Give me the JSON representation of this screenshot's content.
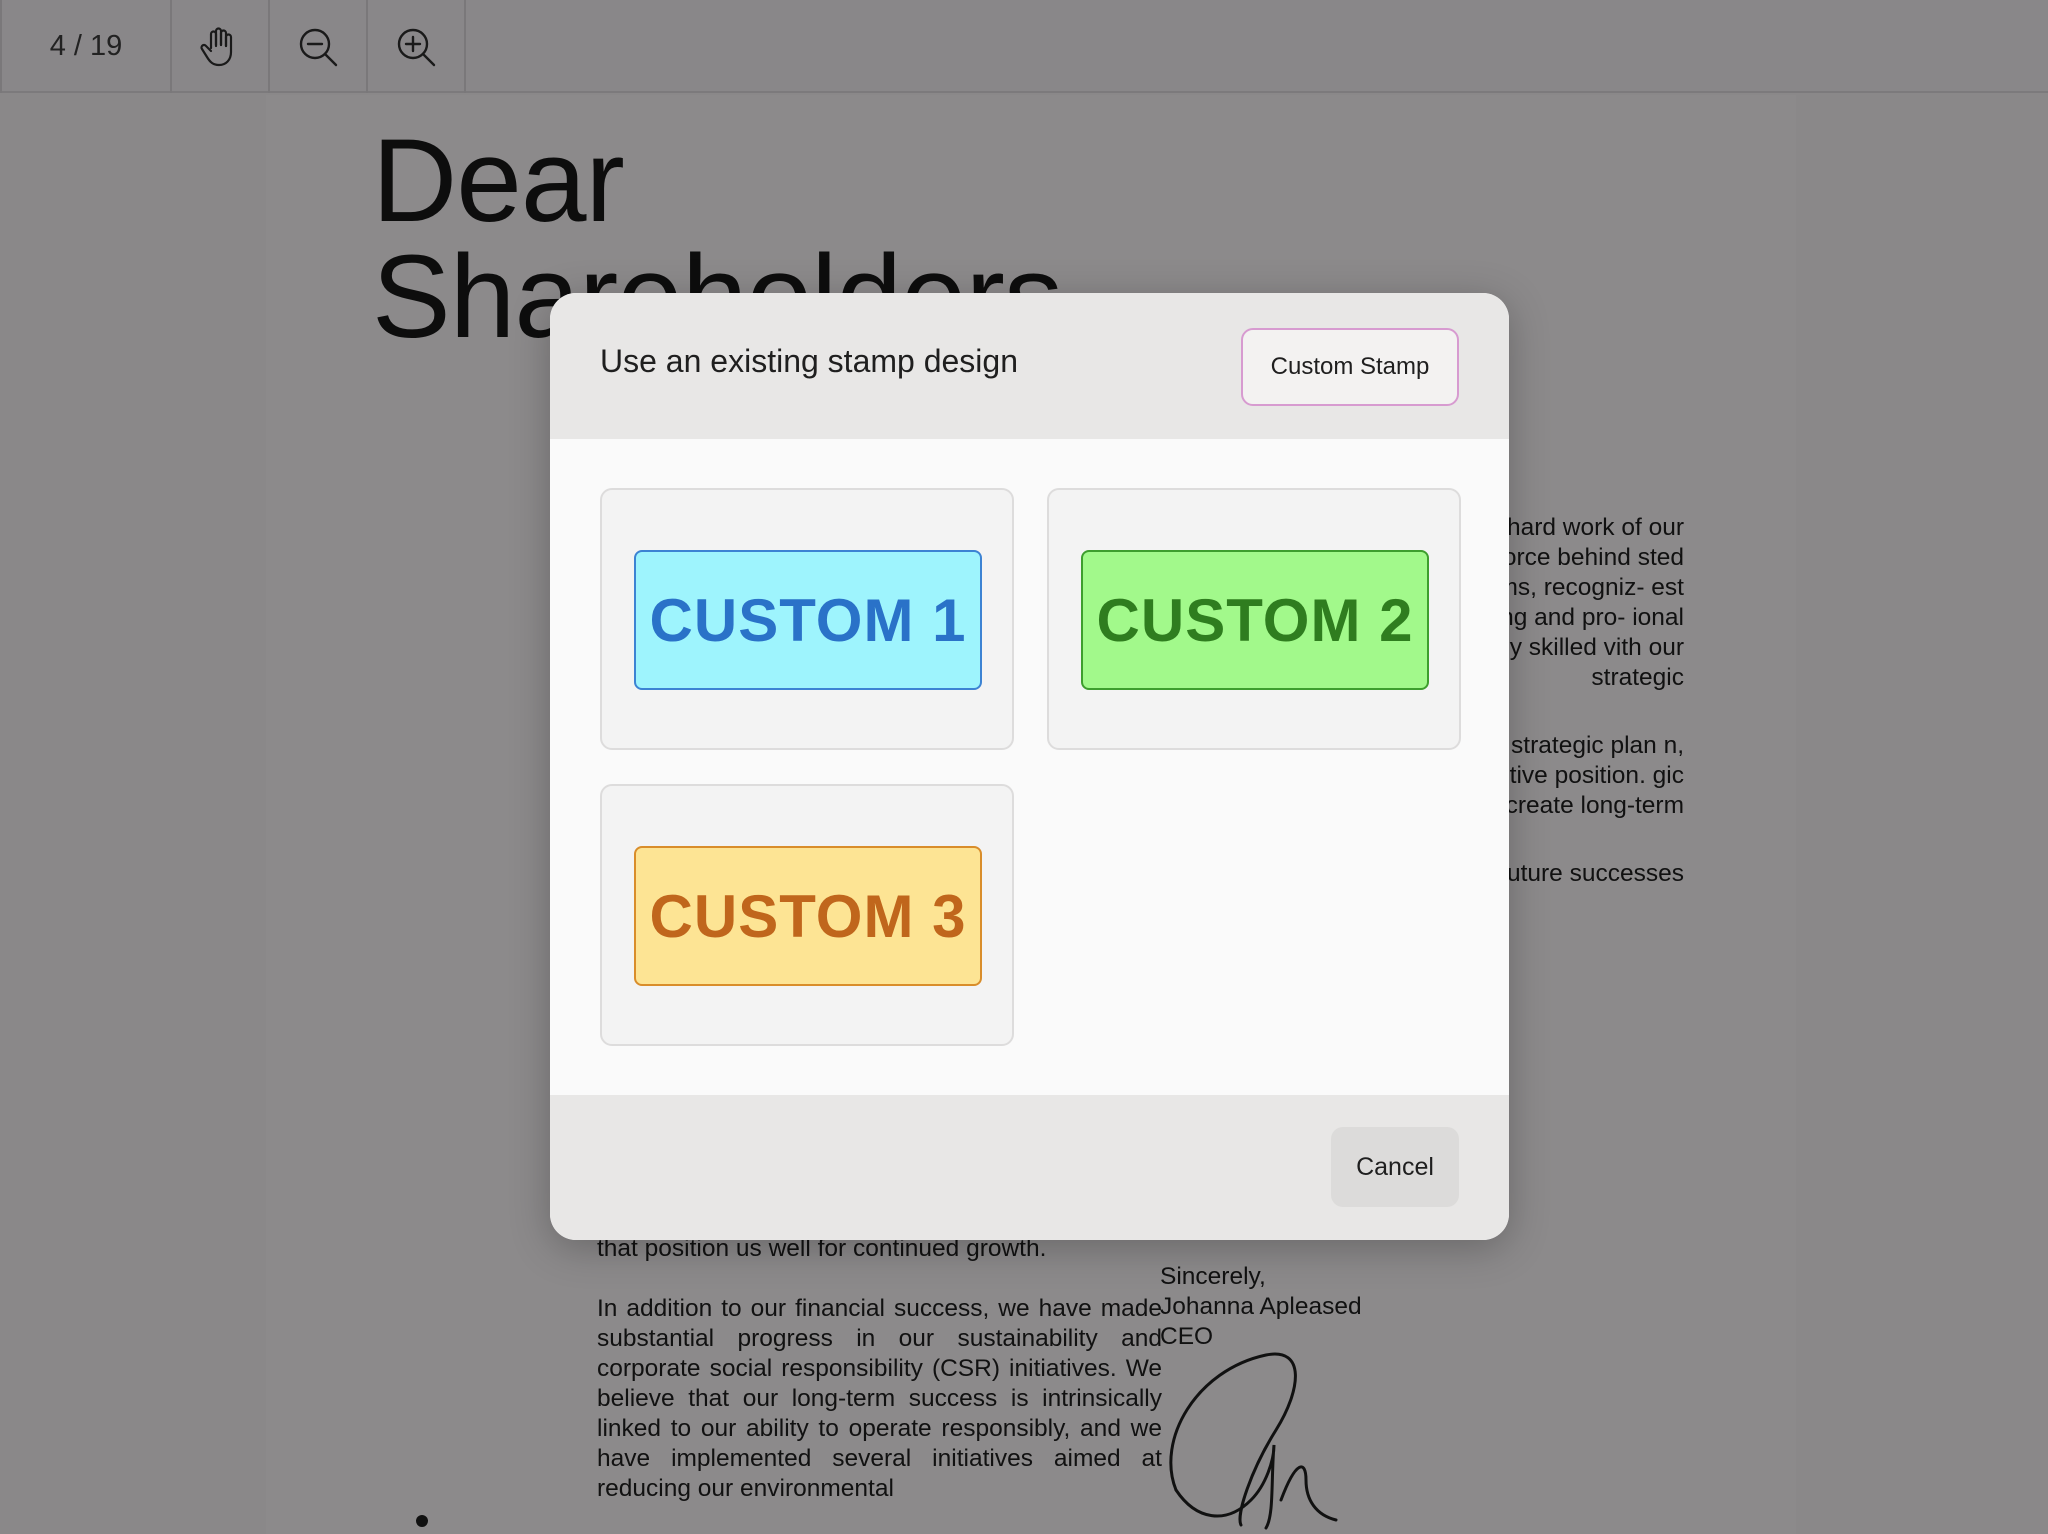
{
  "toolbar": {
    "page_indicator": "4 / 19",
    "buttons": [
      {
        "name": "pan",
        "icon": "hand-icon"
      },
      {
        "name": "zoom-out",
        "icon": "zoom-out-icon"
      },
      {
        "name": "zoom-in",
        "icon": "zoom-in-icon"
      }
    ]
  },
  "document": {
    "headline_line1": "Dear",
    "headline_line2": "Shareholders",
    "right_column": [
      "ave been possi- hard work of our nitment to excel- ing force behind sted significantly grams, recogniz- est asset. By fos- earning and pro- ional growth, we not only skilled vith our strategic",
      "about the op- ur strategic plan n, market expan- petitive position. gic initiatives will create long-term",
      "ust and support. uture successes"
    ],
    "left_bottom_first_line": "that position us well for continued growth.",
    "left_bottom_paragraph": "In addition to our financial success, we have made substantial progress in our sustainability and corporate social responsibility (CSR) initiatives. We believe that our long-term success is intrinsically linked to our ability to operate responsibly, and we have implemented several initiatives aimed at reducing our environmental",
    "closing": "Sincerely,",
    "signer_name": "Johanna Apleased",
    "signer_title": "CEO"
  },
  "modal": {
    "title": "Use an existing stamp design",
    "custom_stamp_label": "Custom Stamp",
    "stamps": [
      {
        "label": "CUSTOM 1",
        "bg": "#9ef4fd",
        "border": "#3c83d3",
        "text": "#2a72c8"
      },
      {
        "label": "CUSTOM 2",
        "bg": "#a2f98b",
        "border": "#3e9e2e",
        "text": "#2f7d1f"
      },
      {
        "label": "CUSTOM 3",
        "bg": "#fde494",
        "border": "#d98d2a",
        "text": "#c0661c"
      }
    ],
    "cancel_label": "Cancel"
  }
}
